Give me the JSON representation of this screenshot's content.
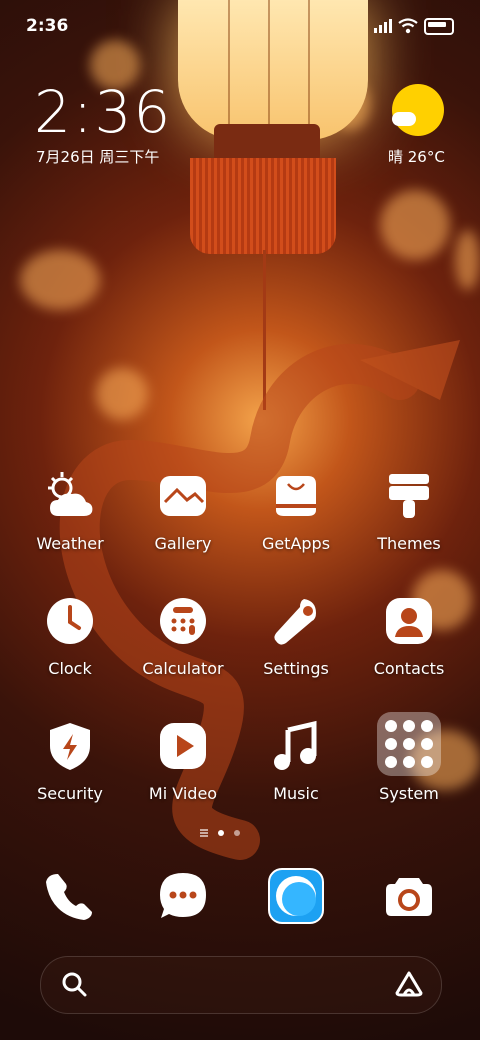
{
  "status_bar": {
    "time": "2:36"
  },
  "clock_widget": {
    "time": "2:36",
    "date": "7月26日 周三下午",
    "weather": "晴 26°C"
  },
  "apps": [
    {
      "label": "Weather",
      "icon": "weather-icon"
    },
    {
      "label": "Gallery",
      "icon": "gallery-icon"
    },
    {
      "label": "GetApps",
      "icon": "getapps-icon"
    },
    {
      "label": "Themes",
      "icon": "themes-icon"
    },
    {
      "label": "Clock",
      "icon": "clock-icon"
    },
    {
      "label": "Calculator",
      "icon": "calculator-icon"
    },
    {
      "label": "Settings",
      "icon": "settings-icon"
    },
    {
      "label": "Contacts",
      "icon": "contacts-icon"
    },
    {
      "label": "Security",
      "icon": "security-icon"
    },
    {
      "label": "Mi Video",
      "icon": "video-icon"
    },
    {
      "label": "Music",
      "icon": "music-icon"
    },
    {
      "label": "System",
      "icon": "folder-icon"
    }
  ],
  "dock": [
    "phone-icon",
    "messages-icon",
    "browser-icon",
    "camera-icon"
  ],
  "search_bar": {
    "left_icon": "search-icon",
    "right_icon": "assistant-icon"
  },
  "colors": {
    "sun": "#ffd000",
    "browser": "#1da1f2"
  }
}
